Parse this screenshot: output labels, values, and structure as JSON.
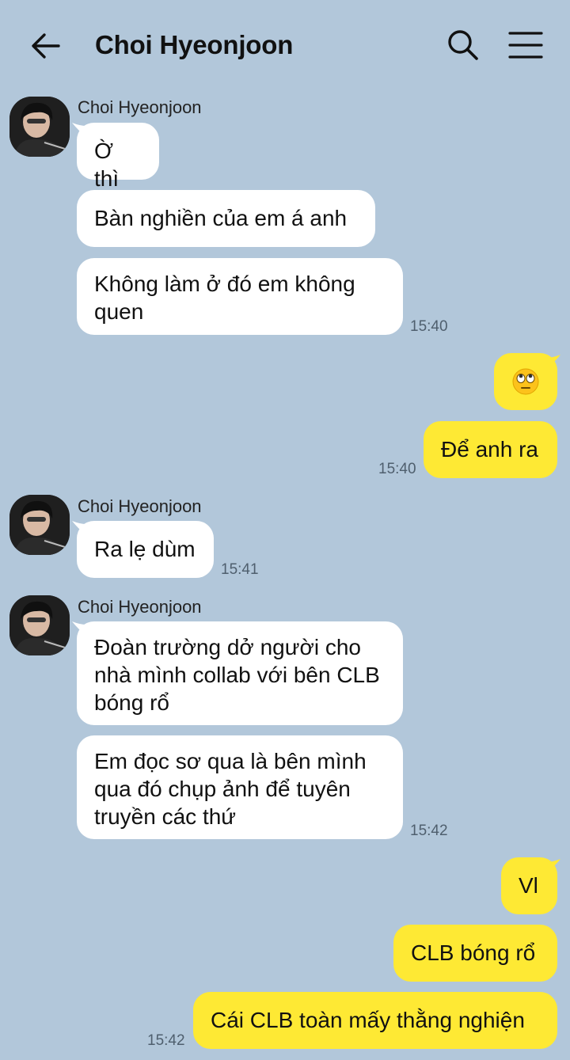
{
  "header": {
    "title": "Choi Hyeonjoon"
  },
  "icons": {
    "back": "arrow-left-icon",
    "search": "search-icon",
    "menu": "hamburger-menu-icon"
  },
  "colors": {
    "background": "#b2c7da",
    "incoming_bubble": "#ffffff",
    "outgoing_bubble": "#fee934"
  },
  "messages": {
    "g1": {
      "sender": "Choi Hyeonjoon",
      "m1": "Ờ thì",
      "m2": "Bàn nghiền của em á anh",
      "m3": "Không làm ở đó em không quen",
      "time": "15:40"
    },
    "g2": {
      "m1_emoji": "face-with-rolling-eyes",
      "m2": "Để anh ra",
      "time": "15:40"
    },
    "g3": {
      "sender": "Choi Hyeonjoon",
      "m1": "Ra lẹ dùm",
      "time": "15:41"
    },
    "g4": {
      "sender": "Choi Hyeonjoon",
      "m1": "Đoàn trường dở người cho nhà mình collab với bên CLB bóng rổ",
      "m2": "Em đọc sơ qua là bên mình qua đó chụp ảnh để tuyên truyền các thứ",
      "time": "15:42"
    },
    "g5": {
      "m1": "Vl",
      "m2": "CLB bóng rổ",
      "m3": "Cái CLB toàn mấy thằng nghiện",
      "time": "15:42"
    }
  }
}
